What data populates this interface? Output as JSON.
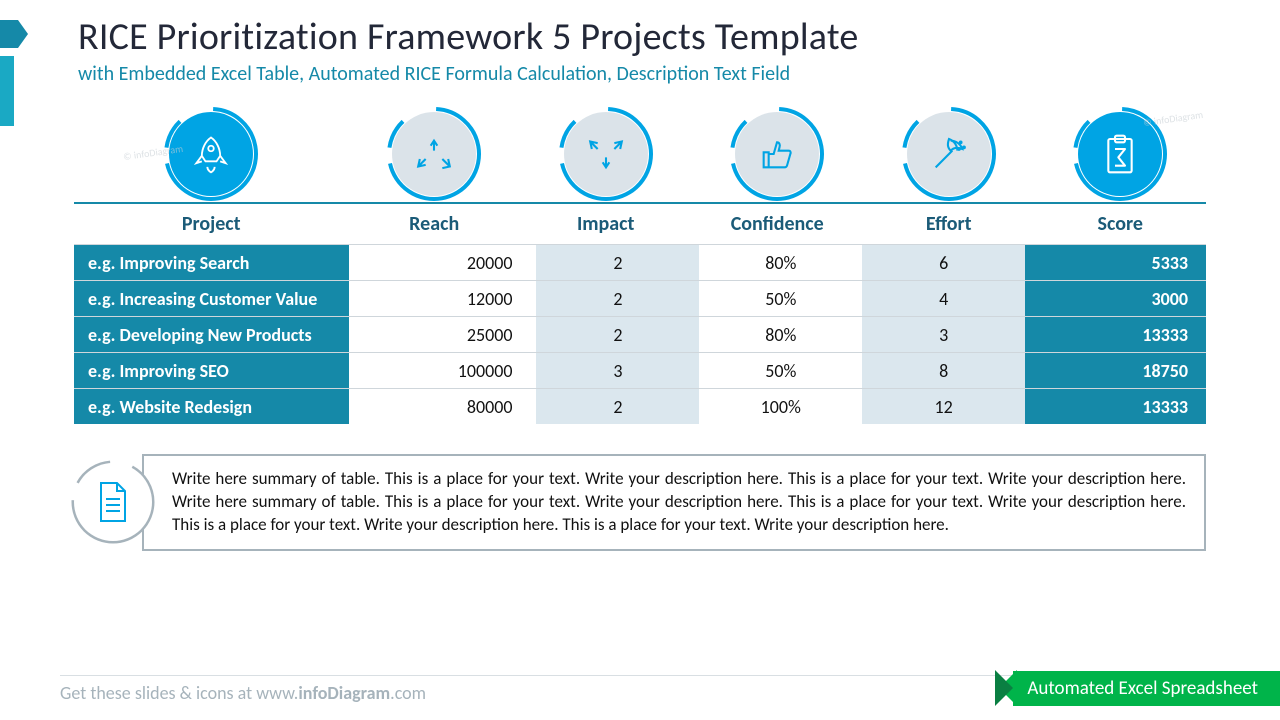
{
  "title": "RICE Prioritization Framework 5 Projects Template",
  "subtitle": "with Embedded Excel Table, Automated RICE Formula Calculation, Description Text Field",
  "watermark": "© infoDiagram",
  "columns": [
    {
      "label": "Project",
      "icon": "rocket",
      "style": "primary"
    },
    {
      "label": "Reach",
      "icon": "arrows-out",
      "style": "secondary"
    },
    {
      "label": "Impact",
      "icon": "arrows-in",
      "style": "secondary"
    },
    {
      "label": "Confidence",
      "icon": "thumbs-up",
      "style": "secondary"
    },
    {
      "label": "Effort",
      "icon": "pickaxe",
      "style": "secondary"
    },
    {
      "label": "Score",
      "icon": "clipboard-sigma",
      "style": "primary"
    }
  ],
  "rows": [
    {
      "project": "e.g. Improving Search",
      "reach": "20000",
      "impact": "2",
      "confidence": "80%",
      "effort": "6",
      "score": "5333"
    },
    {
      "project": "e.g. Increasing Customer Value",
      "reach": "12000",
      "impact": "2",
      "confidence": "50%",
      "effort": "4",
      "score": "3000"
    },
    {
      "project": "e.g. Developing New Products",
      "reach": "25000",
      "impact": "2",
      "confidence": "80%",
      "effort": "3",
      "score": "13333"
    },
    {
      "project": "e.g. Improving SEO",
      "reach": "100000",
      "impact": "3",
      "confidence": "50%",
      "effort": "8",
      "score": "18750"
    },
    {
      "project": "e.g. Website Redesign",
      "reach": "80000",
      "impact": "2",
      "confidence": "100%",
      "effort": "12",
      "score": "13333"
    }
  ],
  "description": "Write here summary of table. This is a place for your text. Write your description here. This is a place for your text. Write your description here. Write here summary of table. This is a place for your text. Write your description here. This is a place for your text. Write your description here. This is a place for your text. Write your description here. This is a place for your text. Write your description here.",
  "footer_prefix": "Get these slides & icons at www.",
  "footer_bold": "infoDiagram",
  "footer_suffix": ".com",
  "ribbon": "Automated Excel Spreadsheet",
  "colors": {
    "accent": "#1589a8",
    "bright": "#00a4e4",
    "pale": "#dbe3e9",
    "green": "#00b44a"
  },
  "chart_data": {
    "type": "table",
    "title": "RICE Prioritization Framework 5 Projects Template",
    "columns": [
      "Project",
      "Reach",
      "Impact",
      "Confidence",
      "Effort",
      "Score"
    ],
    "rows": [
      [
        "e.g. Improving Search",
        20000,
        2,
        "80%",
        6,
        5333
      ],
      [
        "e.g. Increasing Customer Value",
        12000,
        2,
        "50%",
        4,
        3000
      ],
      [
        "e.g. Developing New Products",
        25000,
        2,
        "80%",
        3,
        13333
      ],
      [
        "e.g. Improving SEO",
        100000,
        3,
        "50%",
        8,
        18750
      ],
      [
        "e.g. Website Redesign",
        80000,
        2,
        "100%",
        12,
        13333
      ]
    ]
  }
}
